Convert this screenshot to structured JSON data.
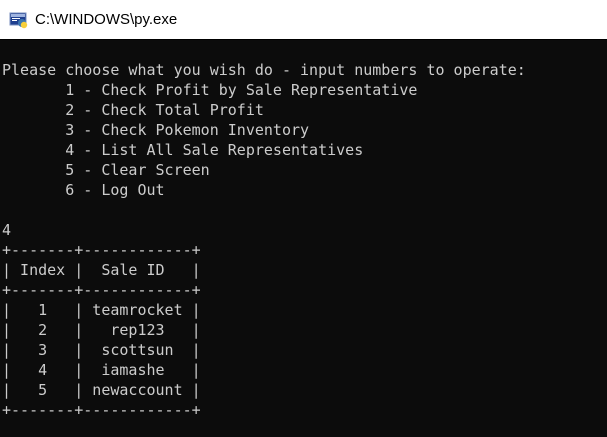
{
  "window": {
    "title": "C:\\WINDOWS\\py.exe",
    "icon": "python-console-icon"
  },
  "console": {
    "prompt": "Please choose what you wish do - input numbers to operate:",
    "menu": [
      "       1 - Check Profit by Sale Representative",
      "       2 - Check Total Profit",
      "       3 - Check Pokemon Inventory",
      "       4 - List All Sale Representatives",
      "       5 - Clear Screen",
      "       6 - Log Out"
    ],
    "user_input": "4",
    "table": {
      "border": "+-------+------------+",
      "header": "| Index |  Sale ID   |",
      "rows": [
        "|   1   | teamrocket |",
        "|   2   |   rep123   |",
        "|   3   |  scottsun  |",
        "|   4   |  iamashe   |",
        "|   5   | newaccount |"
      ]
    }
  },
  "colors": {
    "background": "#0c0c0c",
    "text": "#cccccc",
    "titlebar": "#ffffff"
  }
}
